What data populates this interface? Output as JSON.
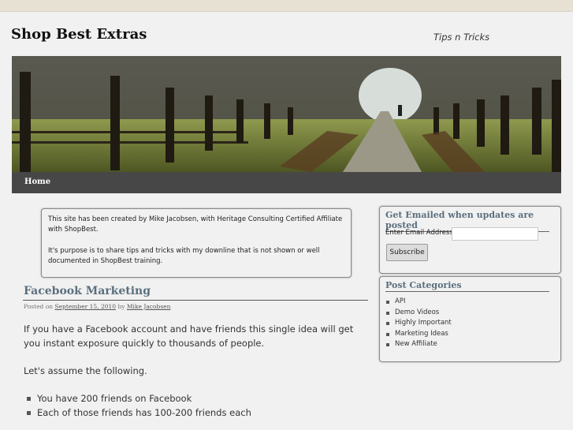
{
  "site": {
    "title": "Shop Best Extras",
    "description": "Tips n Tricks"
  },
  "nav": {
    "items": [
      {
        "label": "Home"
      }
    ]
  },
  "intro": {
    "p1": "This site has been created by Mike Jacobsen, with Heritage Consulting Certified Affiliate with ShopBest.",
    "p2": "It's purpose is to share tips and tricks with my downline that is not shown or well documented in ShopBest training."
  },
  "post": {
    "title": "Facebook Marketing",
    "meta_prefix": "Posted on",
    "date": "September 15, 2010",
    "by": "by",
    "author": "Mike Jacobsen",
    "p1": "If you have a Facebook account and have friends this single idea will get you instant exposure quickly to thousands of people.",
    "p2": "Let's assume the following.",
    "bullets": [
      "You have 200 friends on Facebook",
      "Each of those friends has 100-200 friends each"
    ]
  },
  "sidebar": {
    "email_widget": {
      "title": "Get Emailed when updates are posted",
      "label": "Enter Email Address",
      "value": "",
      "button": "Subscribe"
    },
    "categories_widget": {
      "title": "Post Categories",
      "items": [
        "API",
        "Demo Videos",
        "Highly Important",
        "Marketing Ideas",
        "New Affiliate"
      ]
    }
  }
}
